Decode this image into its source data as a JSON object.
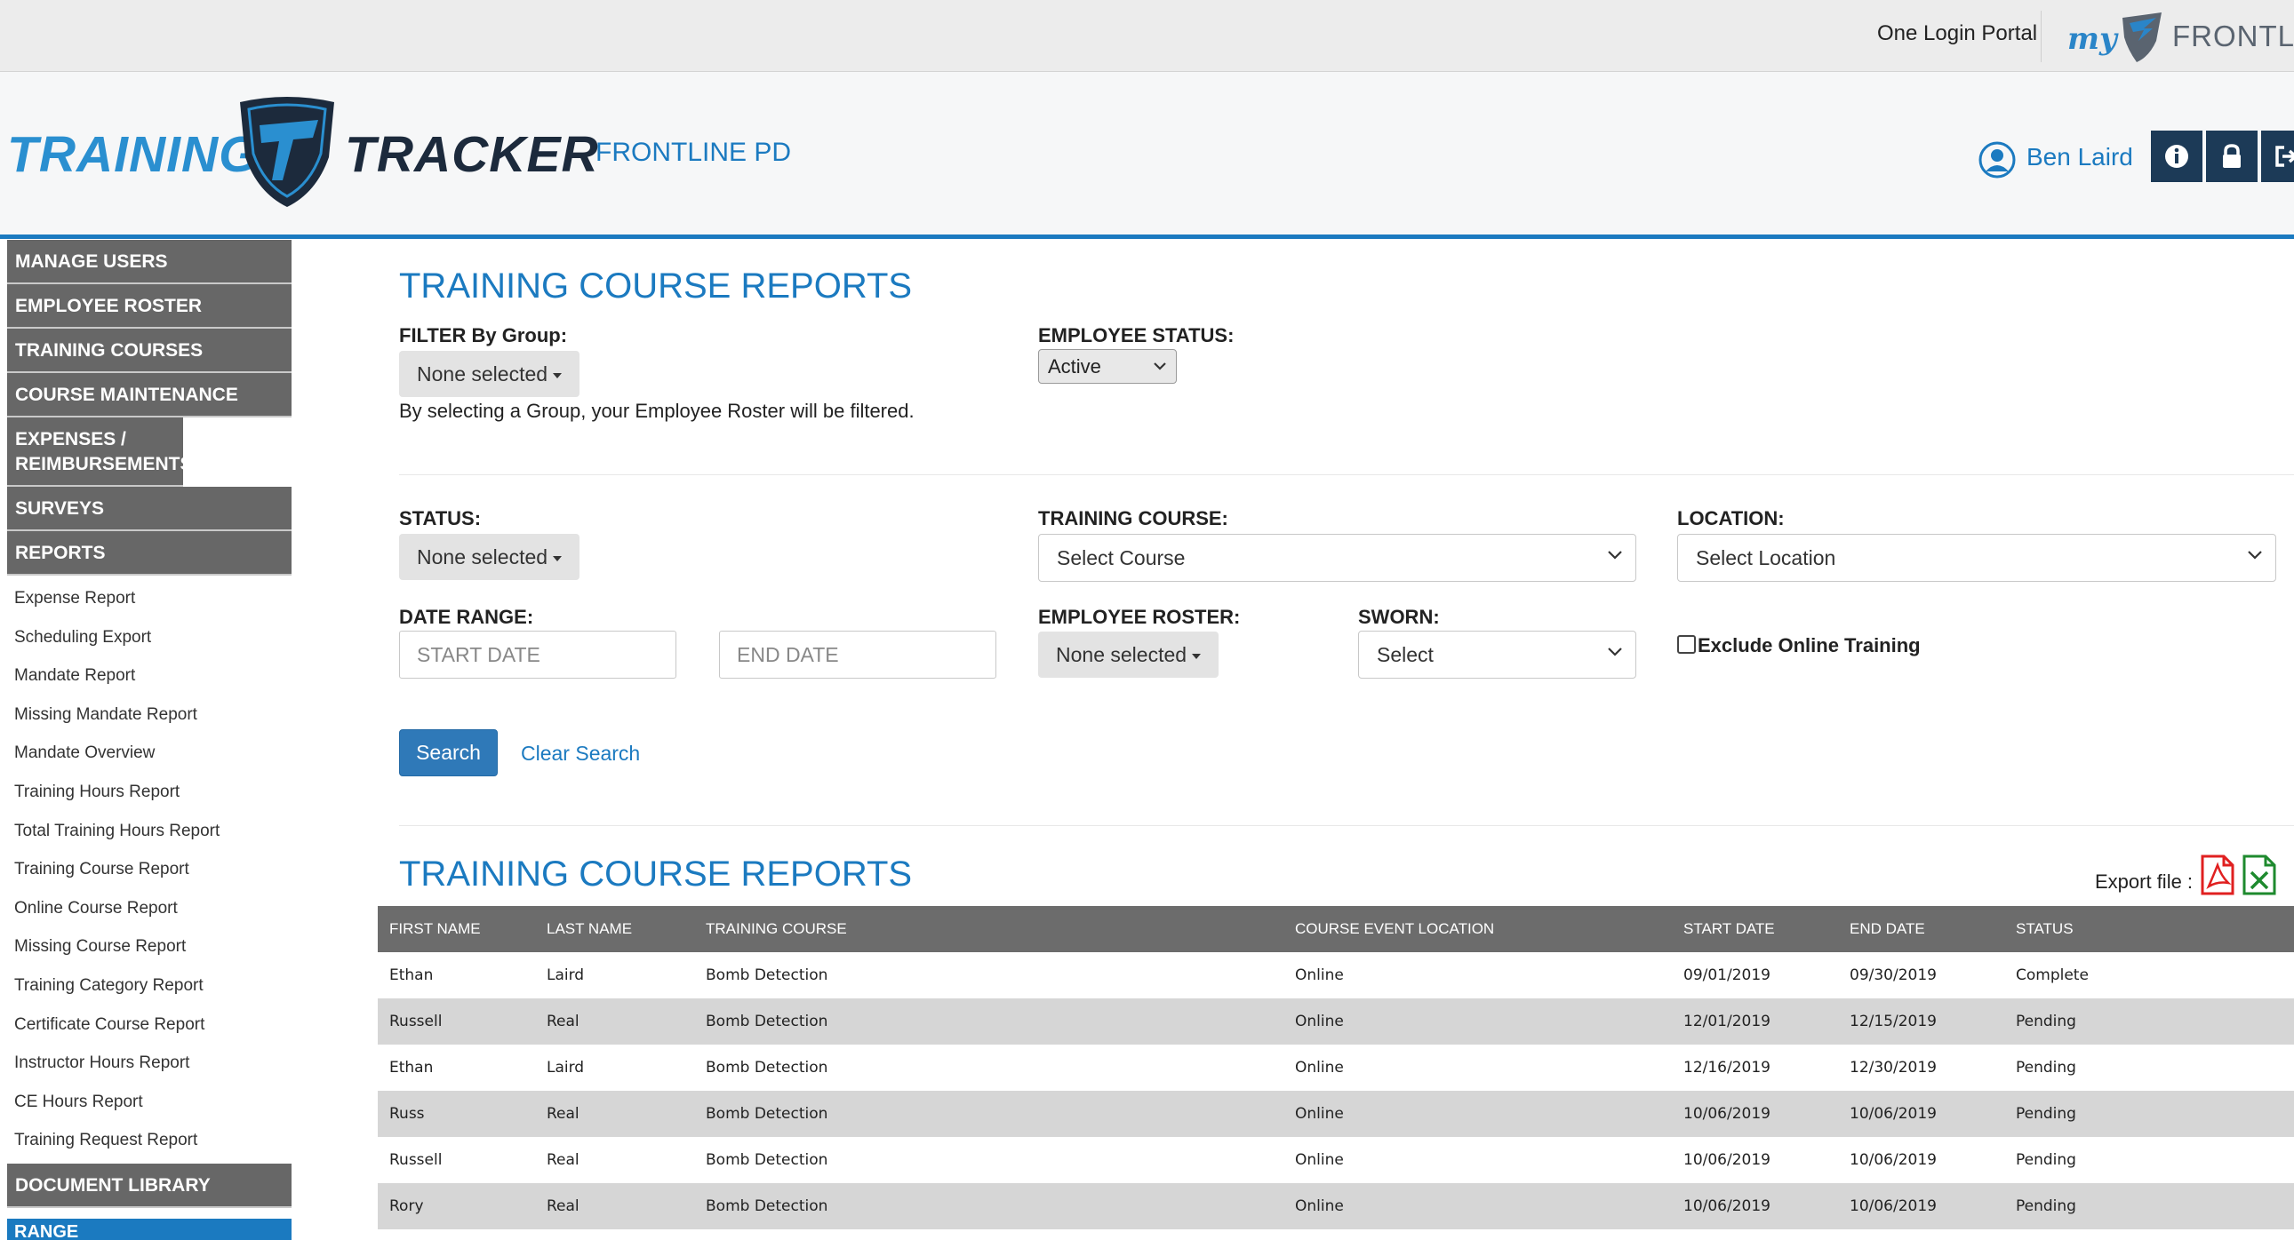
{
  "topbar": {
    "portal_link": "One Login Portal",
    "my_label": "my",
    "brand": "FRONTLINE"
  },
  "header": {
    "logo_left": "TRAINING",
    "logo_right": "TRACKER",
    "agency": "FRONTLINE PD",
    "user_name": "Ben Laird",
    "buttons": [
      "info-icon",
      "lock-icon",
      "logout-icon"
    ]
  },
  "sidebar": {
    "main_items": [
      {
        "label": "MANAGE USERS"
      },
      {
        "label": "EMPLOYEE ROSTER"
      },
      {
        "label": "TRAINING COURSES"
      },
      {
        "label": "COURSE MAINTENANCE"
      },
      {
        "label": "EXPENSES / REIMBURSEMENTS"
      },
      {
        "label": "SURVEYS"
      },
      {
        "label": "REPORTS"
      }
    ],
    "report_items": [
      "Expense Report",
      "Scheduling Export",
      "Mandate Report",
      "Missing Mandate Report",
      "Mandate Overview",
      "Training Hours Report",
      "Total Training Hours Report",
      "Training Course Report",
      "Online Course Report",
      "Missing Course Report",
      "Training Category Report",
      "Certificate Course Report",
      "Instructor Hours Report",
      "CE Hours Report",
      "Training Request Report"
    ],
    "document_library": "DOCUMENT LIBRARY",
    "range": "RANGE"
  },
  "main": {
    "page_title": "TRAINING COURSE REPORTS",
    "filter_group": {
      "label": "FILTER By Group:",
      "value": "None selected",
      "hint": "By selecting a Group, your Employee Roster will be filtered."
    },
    "employee_status": {
      "label": "EMPLOYEE STATUS:",
      "value": "Active"
    },
    "status": {
      "label": "STATUS:",
      "value": "None selected"
    },
    "training_course": {
      "label": "TRAINING COURSE:",
      "value": "Select Course"
    },
    "location": {
      "label": "LOCATION:",
      "value": "Select Location"
    },
    "date_range": {
      "label": "DATE RANGE:",
      "start_placeholder": "START DATE",
      "end_placeholder": "END DATE"
    },
    "employee_roster": {
      "label": "EMPLOYEE ROSTER:",
      "value": "None selected"
    },
    "sworn": {
      "label": "SWORN:",
      "value": "Select"
    },
    "exclude_online": "Exclude Online Training",
    "search_label": "Search",
    "clear_label": "Clear Search",
    "section_title": "TRAINING COURSE REPORTS",
    "export_label": "Export file :"
  },
  "table": {
    "columns": [
      "FIRST NAME",
      "LAST NAME",
      "TRAINING COURSE",
      "COURSE EVENT LOCATION",
      "START DATE",
      "END DATE",
      "STATUS"
    ],
    "rows": [
      [
        "Ethan",
        "Laird",
        "Bomb Detection",
        "Online",
        "09/01/2019",
        "09/30/2019",
        "Complete"
      ],
      [
        "Russell",
        "Real",
        "Bomb Detection",
        "Online",
        "12/01/2019",
        "12/15/2019",
        "Pending"
      ],
      [
        "Ethan",
        "Laird",
        "Bomb Detection",
        "Online",
        "12/16/2019",
        "12/30/2019",
        "Pending"
      ],
      [
        "Russ",
        "Real",
        "Bomb Detection",
        "Online",
        "10/06/2019",
        "10/06/2019",
        "Pending"
      ],
      [
        "Russell",
        "Real",
        "Bomb Detection",
        "Online",
        "10/06/2019",
        "10/06/2019",
        "Pending"
      ],
      [
        "Rory",
        "Real",
        "Bomb Detection",
        "Online",
        "10/06/2019",
        "10/06/2019",
        "Pending"
      ]
    ]
  },
  "colors": {
    "accent": "#1b7ac0",
    "nav_bg": "#676767",
    "header_button": "#1c3a57",
    "pdf_red": "#e02020",
    "excel_green": "#1e8a2e"
  }
}
